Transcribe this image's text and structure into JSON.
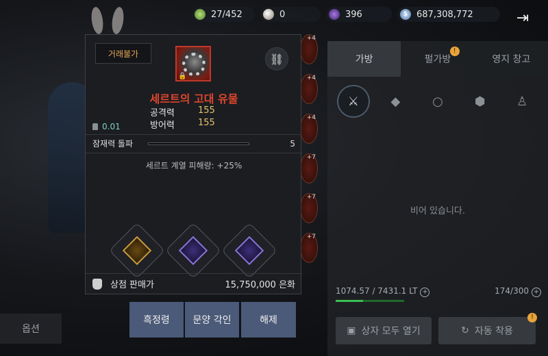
{
  "currencies": {
    "energy": "27/452",
    "pearl": "0",
    "gem": "396",
    "silver": "687,308,772"
  },
  "popup": {
    "trade_badge": "거래불가",
    "item_name": "세르트의 고대 유물",
    "stats": [
      {
        "label": "공격력",
        "value": "155"
      },
      {
        "label": "방어력",
        "value": "155"
      }
    ],
    "weight": "0.01",
    "potential": {
      "label": "잠재력 돌파",
      "value": "5"
    },
    "effect": "세르트 계열 피해량: +25%",
    "sockets": [
      "gold",
      "purple",
      "purple"
    ],
    "sell": {
      "label": "상점 판매가",
      "price": "15,750,000 은화"
    }
  },
  "actions": [
    "흑정령",
    "문양 각인",
    "해제"
  ],
  "inventory": {
    "tabs": [
      "가방",
      "펄가방",
      "영지 창고"
    ],
    "tab_badge": "!",
    "empty_text": "비어 있습니다.",
    "weight_text": "1074.57 / 7431.1 LT",
    "slots_text": "174/300",
    "weight_fill": 0.4,
    "open_all": "상자 모두 열기",
    "auto_equip": "자동 착용",
    "equip_badge": "!"
  },
  "option_label": "옵션",
  "slot_badges": [
    "+4",
    "+4",
    "+4",
    "+7",
    "+7",
    "+7"
  ]
}
